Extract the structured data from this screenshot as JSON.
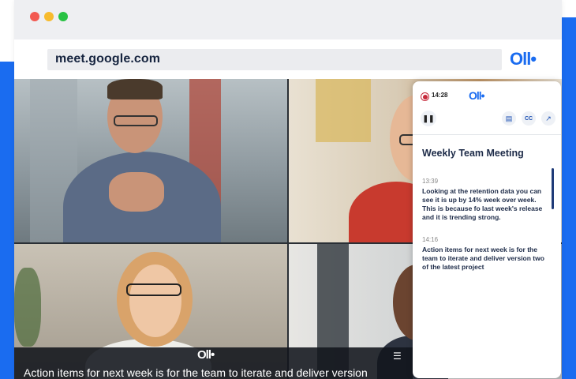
{
  "browser": {
    "url": "meet.google.com",
    "brand_logo": "Oll•",
    "traffic_lights": [
      "close",
      "minimize",
      "maximize"
    ]
  },
  "video_tiles": [
    {
      "participant": "man-with-glasses"
    },
    {
      "participant": "woman-smiling"
    },
    {
      "participant": "woman-blonde-glasses"
    },
    {
      "participant": "man-smiling"
    }
  ],
  "otter_panel": {
    "logo": "Oll•",
    "recording_time": "14:28",
    "meeting_title": "Weekly Team Meeting",
    "icons": [
      "pause-icon",
      "notes-icon",
      "cc-icon",
      "share-icon"
    ],
    "cc_label": "CC",
    "transcript": [
      {
        "time": "13:39",
        "text": "Looking at the retention data you can see it is up by 14% week over week. This is because fo last week's release and it is trending strong."
      },
      {
        "time": "14:16",
        "text": "Action items for next week is for the team to iterate and deliver version two of the latest project"
      }
    ]
  },
  "caption_bar": {
    "logo": "Oll•",
    "text": "Action items for next week is for the team to iterate and deliver version"
  },
  "colors": {
    "brand_blue": "#1a6cf0",
    "record_red": "#c6293a",
    "title_navy": "#1d2b48"
  }
}
